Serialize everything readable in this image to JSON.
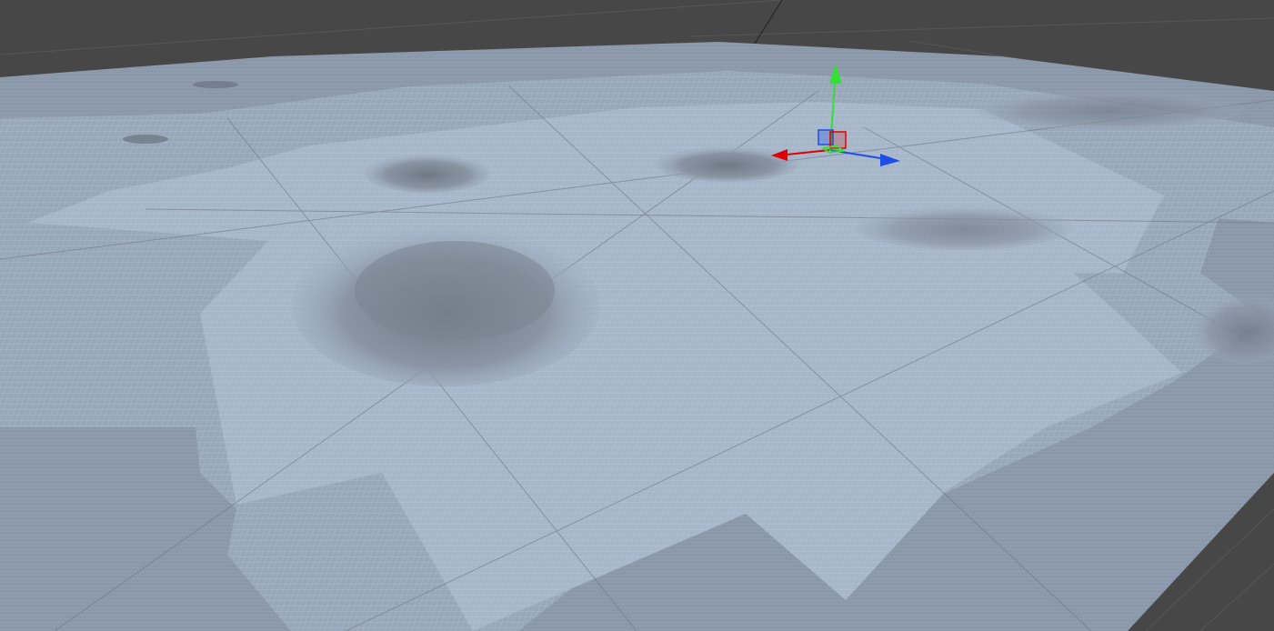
{
  "app": {
    "view": "scene-viewport",
    "shading": "wireframe"
  },
  "colors": {
    "background": "#474747",
    "terrain_far": "#8796a8",
    "terrain_near": "#9fb1c6",
    "terrain_lod_fine": "#a7b8cb",
    "wire": "#c4d1e0",
    "grid_line": "#5c5c5c",
    "mountain_shade": "#7b8592",
    "gizmo_x": "#e00000",
    "gizmo_y": "#33e033",
    "gizmo_z": "#1d4fe8"
  },
  "icons": {
    "transform_gizmo": "move-gizmo-icon",
    "axis_x": "x-axis-handle-icon",
    "axis_y": "y-axis-handle-icon",
    "axis_z": "z-axis-handle-icon"
  }
}
